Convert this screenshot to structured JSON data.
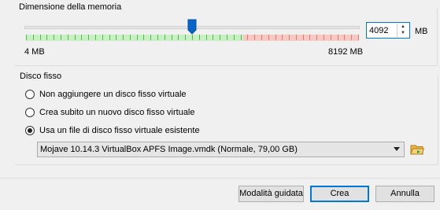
{
  "memory": {
    "title": "Dimensione della memoria",
    "value": "4092",
    "unit": "MB",
    "min_label": "4 MB",
    "max_label": "8192 MB",
    "level_fraction": 0.4995
  },
  "disk": {
    "title": "Disco fisso",
    "options": [
      {
        "label": "Non aggiungere un disco fisso virtuale",
        "checked": false
      },
      {
        "label": "Crea subito un nuovo disco fisso virtuale",
        "checked": false
      },
      {
        "label": "Usa un file di disco fisso virtuale esistente",
        "checked": true
      }
    ],
    "selected_file": "Mojave 10.14.3 VirtualBox APFS Image.vmdk (Normale, 79,00 GB)"
  },
  "buttons": {
    "guided": "Modalità guidata",
    "create": "Crea",
    "cancel": "Annulla"
  },
  "colors": {
    "safe_range": "#c8f0c4",
    "warning_range": "#f7c9c4",
    "slider_thumb": "#0a64c8",
    "focus_border": "#0078d7"
  }
}
